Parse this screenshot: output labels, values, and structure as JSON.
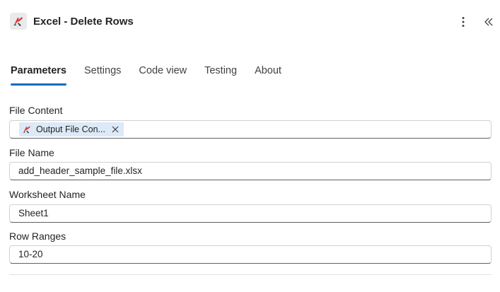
{
  "header": {
    "title": "Excel - Delete Rows",
    "logo_icon": "excel-connector-logo-icon",
    "more_icon": "more-vertical-icon",
    "collapse_icon": "double-chevron-left-icon"
  },
  "tabs": [
    {
      "label": "Parameters",
      "active": true
    },
    {
      "label": "Settings",
      "active": false
    },
    {
      "label": "Code view",
      "active": false
    },
    {
      "label": "Testing",
      "active": false
    },
    {
      "label": "About",
      "active": false
    }
  ],
  "fields": {
    "file_content": {
      "label": "File Content",
      "token_label": "Output File Con...",
      "token_icon": "excel-connector-logo-icon",
      "token_close_icon": "close-icon"
    },
    "file_name": {
      "label": "File Name",
      "value": "add_header_sample_file.xlsx"
    },
    "worksheet_name": {
      "label": "Worksheet Name",
      "value": "Sheet1"
    },
    "row_ranges": {
      "label": "Row Ranges",
      "value": "10-20"
    }
  },
  "colors": {
    "accent": "#0f6cbd",
    "token_bg": "#dce9f7",
    "logo_red": "#d13438"
  }
}
